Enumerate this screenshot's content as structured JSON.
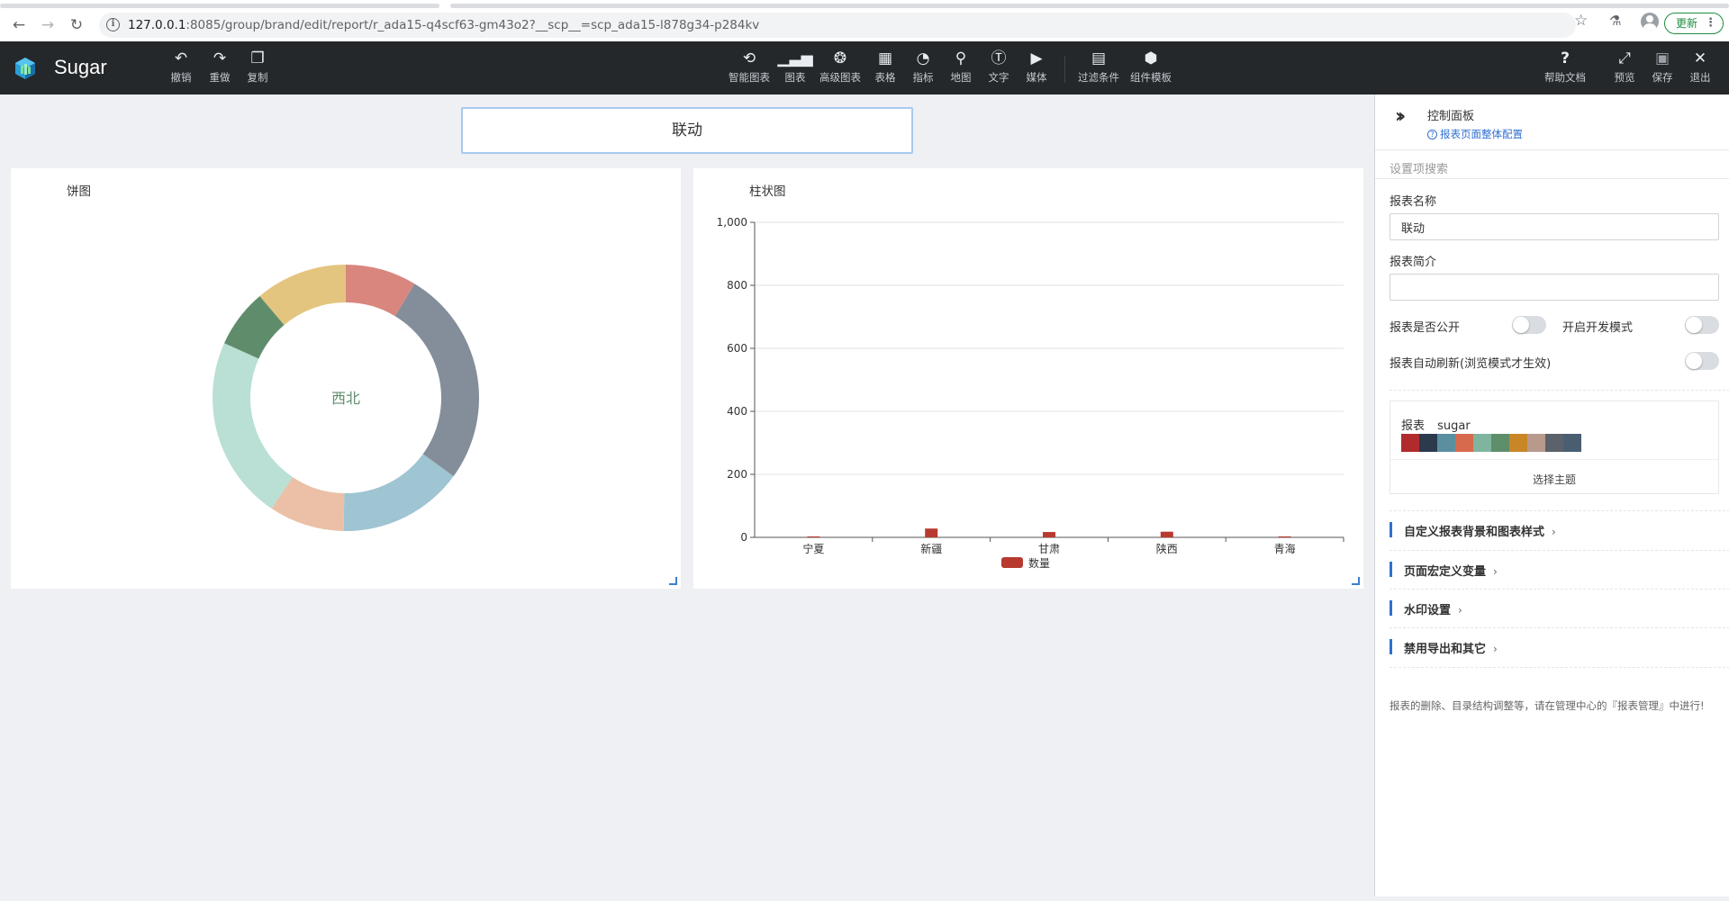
{
  "browser": {
    "url_host": "127.0.0.1",
    "url_rest": ":8085/group/brand/edit/report/r_ada15-q4scf63-gm43o2?__scp__=scp_ada15-l878g34-p284kv",
    "update_label": "更新"
  },
  "app": {
    "brand": "Sugar",
    "history_tools": [
      {
        "label": "撤销",
        "icon": "undo-icon"
      },
      {
        "label": "重做",
        "icon": "redo-icon"
      },
      {
        "label": "复制",
        "icon": "copy-icon"
      }
    ],
    "insert_tools": [
      {
        "label": "智能图表",
        "icon": "smart-chart-icon"
      },
      {
        "label": "图表",
        "icon": "bar-chart-icon"
      },
      {
        "label": "高级图表",
        "icon": "advanced-chart-icon"
      },
      {
        "label": "表格",
        "icon": "table-icon"
      },
      {
        "label": "指标",
        "icon": "gauge-icon"
      },
      {
        "label": "地图",
        "icon": "map-pin-icon"
      },
      {
        "label": "文字",
        "icon": "text-icon"
      },
      {
        "label": "媒体",
        "icon": "media-icon"
      },
      {
        "label": "过滤条件",
        "icon": "filter-calendar-icon"
      },
      {
        "label": "组件模板",
        "icon": "component-template-icon"
      }
    ],
    "right_tools": [
      {
        "label": "帮助文档",
        "icon": "help-icon"
      },
      {
        "label": "预览",
        "icon": "expand-icon"
      },
      {
        "label": "保存",
        "icon": "save-icon"
      },
      {
        "label": "退出",
        "icon": "close-icon"
      }
    ]
  },
  "report": {
    "title": "联动"
  },
  "pie_card": {
    "title": "饼图",
    "center_label": "西北"
  },
  "bar_card": {
    "title": "柱状图"
  },
  "chart_data": [
    {
      "type": "pie",
      "title": "饼图",
      "donut": true,
      "center_label": "西北",
      "slices": [
        {
          "value": 8.5,
          "color": "#d9867f"
        },
        {
          "value": 26,
          "color": "#848e9a"
        },
        {
          "value": 15,
          "color": "#9fc4d2"
        },
        {
          "value": 9,
          "color": "#ebc0a6"
        },
        {
          "value": 22,
          "color": "#badfd5"
        },
        {
          "value": 7,
          "color": "#5f8d6c"
        },
        {
          "value": 11,
          "color": "#e3c57f"
        }
      ]
    },
    {
      "type": "bar",
      "title": "柱状图",
      "categories": [
        "宁夏",
        "新疆",
        "甘肃",
        "陕西",
        "青海"
      ],
      "series": [
        {
          "name": "数量",
          "values": [
            3,
            28,
            17,
            18,
            3
          ],
          "color": "#b83a2e"
        }
      ],
      "ylim": [
        0,
        1000
      ],
      "yticks": [
        "0",
        "200",
        "400",
        "600",
        "800",
        "1,000"
      ],
      "grid": true,
      "legend": "bottom-center"
    }
  ],
  "panel": {
    "title": "控制面板",
    "config_link": "报表页面整体配置",
    "search_placeholder": "设置项搜索",
    "name_label": "报表名称",
    "name_value": "联动",
    "intro_label": "报表简介",
    "intro_value": "",
    "public_label": "报表是否公开",
    "public_on": false,
    "devmode_label": "开启开发模式",
    "devmode_on": false,
    "autorefresh_label": "报表自动刷新(浏览模式才生效)",
    "autorefresh_on": false,
    "theme_prefix": "报表",
    "theme_name": "sugar",
    "theme_colors": [
      "#b22b2c",
      "#2c3a4e",
      "#5a8fa0",
      "#d76a4e",
      "#7fb59e",
      "#5e8e6a",
      "#c98627",
      "#b79a8c",
      "#5b626c",
      "#4a5e72"
    ],
    "choose_theme": "选择主题",
    "sections": [
      "自定义报表背景和图表样式",
      "页面宏定义变量",
      "水印设置",
      "禁用导出和其它"
    ],
    "footnote": "报表的删除、目录结构调整等，请在管理中心的『报表管理』中进行!"
  }
}
